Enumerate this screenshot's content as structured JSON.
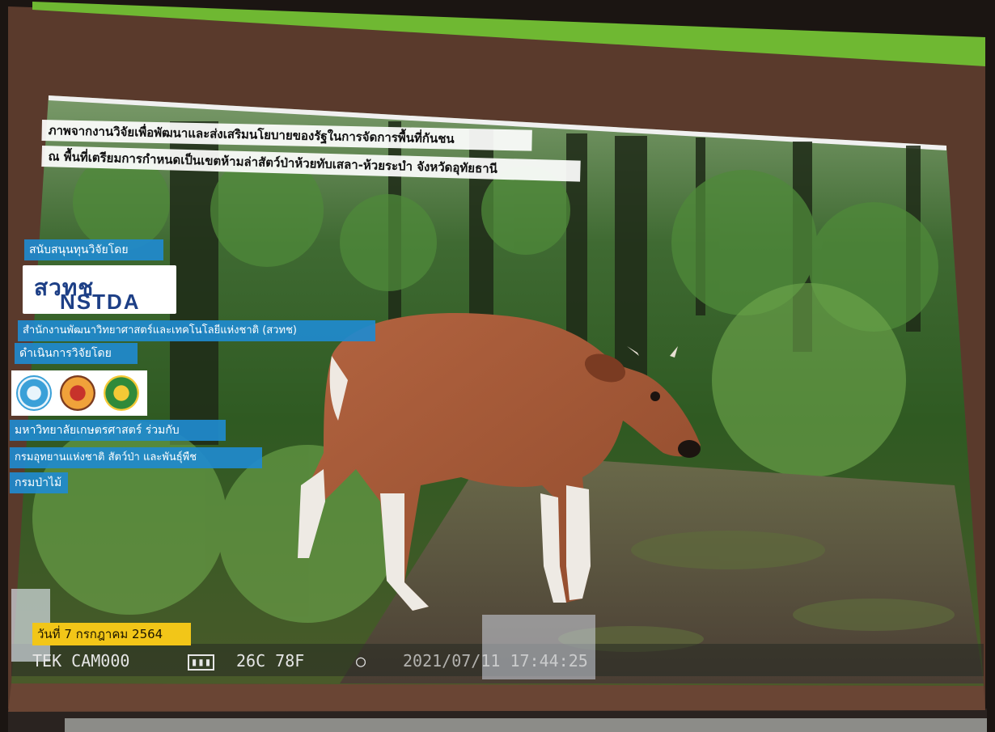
{
  "photo": {
    "title_line_1": "ภาพจากงานวิจัยเพื่อพัฒนาและส่งเสริมนโยบายของรัฐในการจัดการพื้นที่กันชน",
    "title_line_2": "ณ พื้นที่เตรียมการกำหนดเป็นเขตห้ามล่าสัตว์ป่าห้วยทับเสลา-ห้วยระบำ จังหวัดอุทัยธานี",
    "funded_by_label": "สนับสนุนทุนวิจัยโดย",
    "nstda_logo_thai": "สวทช",
    "nstda_logo_en": "NSTDA",
    "agency_label": "สำนักงานพัฒนาวิทยาศาสตร์และเทคโนโลยีแห่งชาติ (สวทช)",
    "conducted_by_label": "ดำเนินการวิจัยโดย",
    "university_label": "มหาวิทยาลัยเกษตรศาสตร์ ร่วมกับ",
    "department_label": "กรมอุทยานแห่งชาติ สัตว์ป่า และพันธุ์พืช",
    "forest_label": "กรมป่าไม้",
    "date_label": "วันที่ 7 กรกฎาคม 2564",
    "camera_id": "TEK CAM000",
    "camera_temp": "26C 78F",
    "camera_timestamp": "2021/07/11 17:44:25"
  },
  "colors": {
    "blue_tag": "#208ace",
    "date_tag": "#f2c618",
    "frame": "#5a3a2c"
  }
}
